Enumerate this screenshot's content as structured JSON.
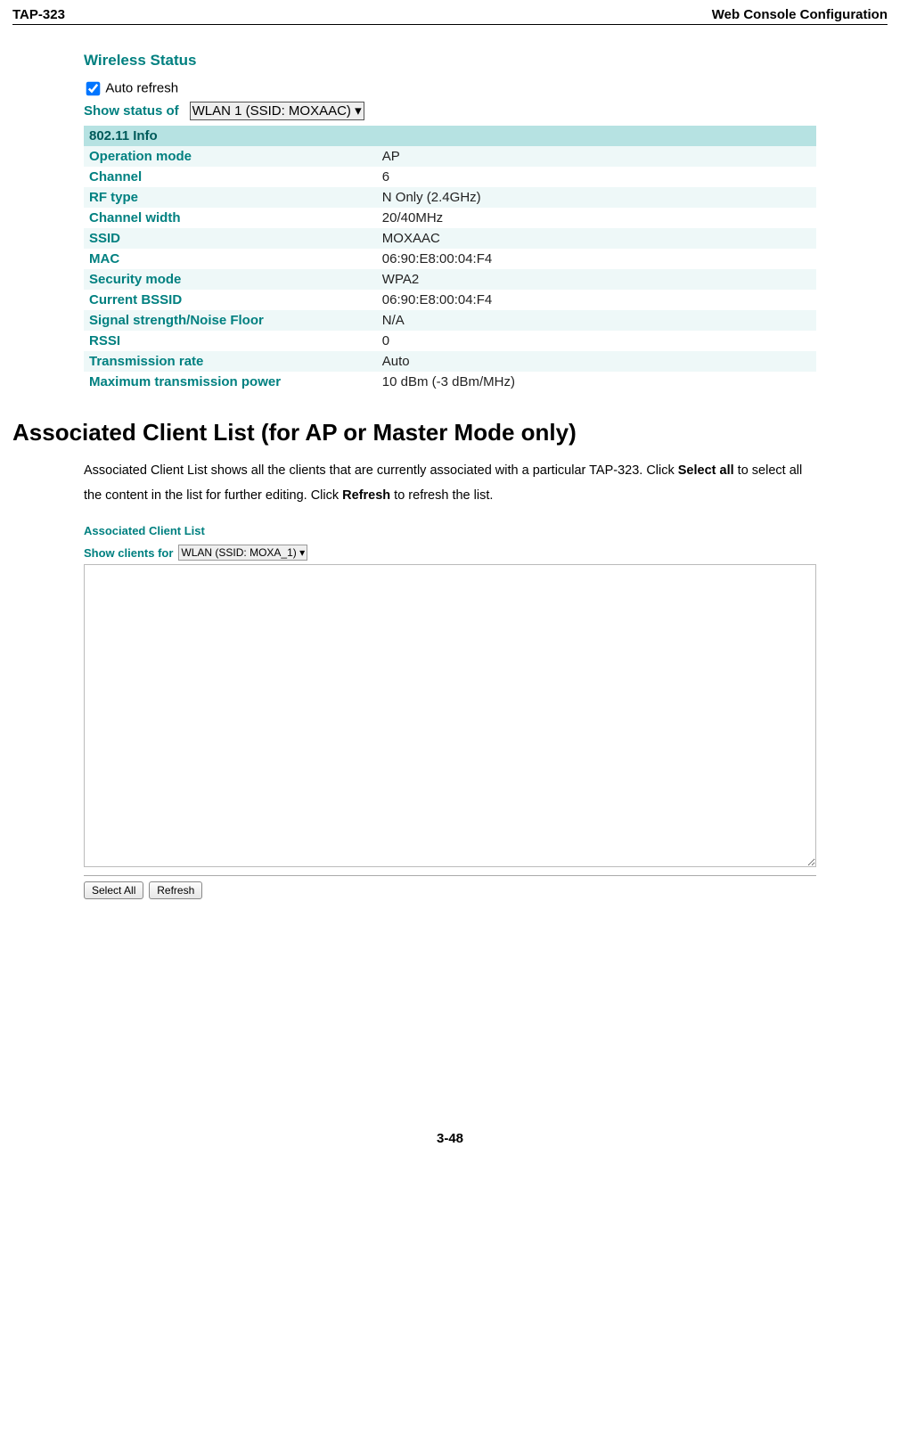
{
  "header": {
    "left": "TAP-323",
    "right": "Web Console Configuration"
  },
  "wireless_status": {
    "title": "Wireless Status",
    "auto_refresh_label": "Auto refresh",
    "show_status_label": "Show status of",
    "show_status_value": "WLAN 1 (SSID: MOXAAC)",
    "section_header": "802.11 Info",
    "rows": [
      {
        "label": "Operation mode",
        "value": "AP"
      },
      {
        "label": "Channel",
        "value": "6"
      },
      {
        "label": "RF type",
        "value": "N Only (2.4GHz)"
      },
      {
        "label": "Channel width",
        "value": "20/40MHz"
      },
      {
        "label": "SSID",
        "value": "MOXAAC"
      },
      {
        "label": "MAC",
        "value": "06:90:E8:00:04:F4"
      },
      {
        "label": "Security mode",
        "value": "WPA2"
      },
      {
        "label": "Current BSSID",
        "value": "06:90:E8:00:04:F4"
      },
      {
        "label": "Signal strength/Noise Floor",
        "value": "N/A"
      },
      {
        "label": "RSSI",
        "value": "0"
      },
      {
        "label": "Transmission rate",
        "value": "Auto"
      },
      {
        "label": "Maximum transmission power",
        "value": "10 dBm (-3 dBm/MHz)"
      }
    ]
  },
  "section_heading": "Associated Client List (for AP or Master Mode only)",
  "body_text": {
    "part1": "Associated Client List shows all the clients that are currently associated with a particular TAP-323. Click ",
    "bold1": "Select all",
    "part2": " to select all the content in the list for further editing. Click ",
    "bold2": "Refresh",
    "part3": " to refresh the list."
  },
  "client_list": {
    "title": "Associated Client List",
    "show_clients_label": "Show clients for",
    "show_clients_value": "WLAN (SSID: MOXA_1)",
    "textarea_value": "",
    "select_all_label": "Select All",
    "refresh_label": "Refresh"
  },
  "page_number": "3-48"
}
